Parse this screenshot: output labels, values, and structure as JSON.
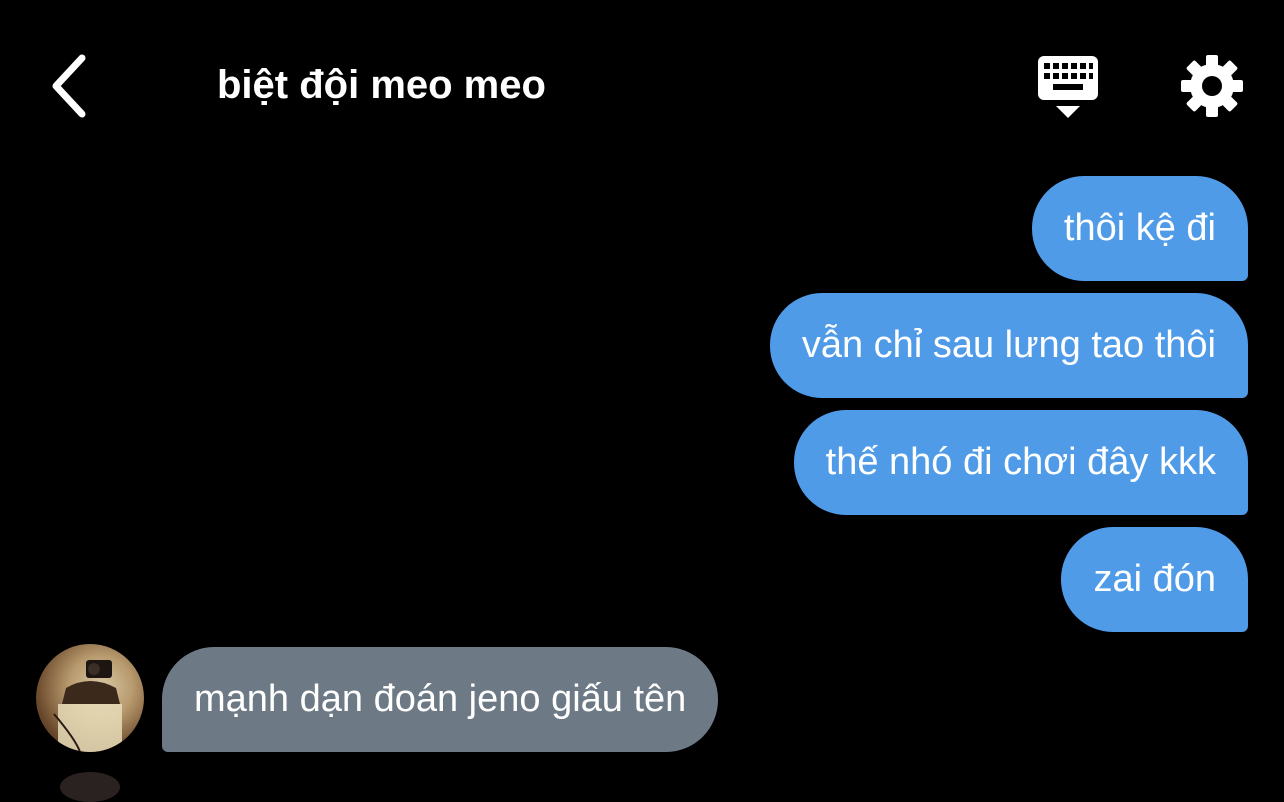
{
  "header": {
    "title": "biệt đội meo meo"
  },
  "icons": {
    "back": "chevron-left-icon",
    "keyboard": "keyboard-hide-icon",
    "settings": "gear-icon"
  },
  "colors": {
    "background": "#000000",
    "outgoing_bubble": "#4f9be8",
    "incoming_bubble": "#6d7a86",
    "text": "#ffffff"
  },
  "messages": [
    {
      "direction": "outgoing",
      "text": "thôi kệ đi"
    },
    {
      "direction": "outgoing",
      "text": "vẫn chỉ sau lưng tao thôi"
    },
    {
      "direction": "outgoing",
      "text": "thế nhó đi chơi đây kkk"
    },
    {
      "direction": "outgoing",
      "text": "zai đón"
    },
    {
      "direction": "incoming",
      "text": "mạnh dạn đoán jeno giấu tên"
    }
  ]
}
